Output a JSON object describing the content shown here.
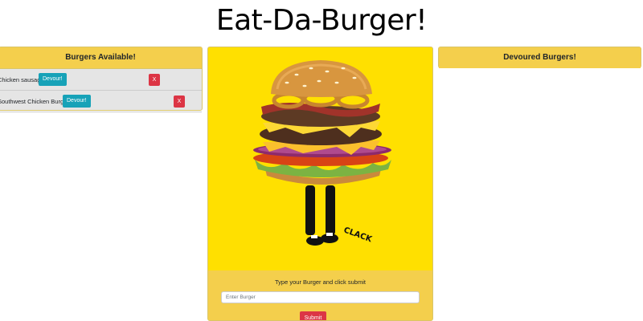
{
  "header": {
    "title": "Eat-Da-Burger!"
  },
  "available": {
    "heading": "Burgers Available!",
    "items": [
      {
        "name": "Chicken sausage",
        "devour_label": "Devour!",
        "delete_label": "X"
      },
      {
        "name": "Southwest Chicken Burger",
        "devour_label": "Devour!",
        "delete_label": "X"
      }
    ]
  },
  "devoured": {
    "heading": "Devoured Burgers!"
  },
  "form": {
    "instruction": "Type your Burger and click submit",
    "placeholder": "Enter Burger",
    "value": "",
    "submit_label": "Submit"
  },
  "illustration": {
    "sound_effect": "CLACK"
  },
  "colors": {
    "card_header": "#f4cf4c",
    "image_background": "#ffe000",
    "devour_button": "#17a2b8",
    "delete_button": "#dc3545",
    "submit_button": "#dc3545"
  }
}
